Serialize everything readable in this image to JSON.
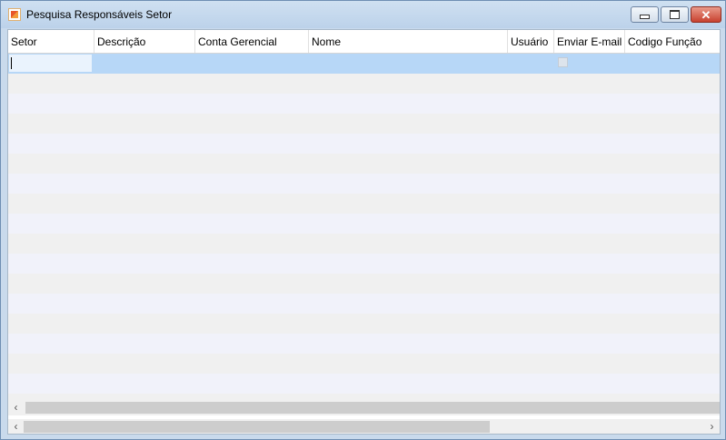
{
  "window": {
    "title": "Pesquisa Responsáveis Setor"
  },
  "grid": {
    "columns": [
      "Setor",
      "Descrição",
      "Conta Gerencial",
      "Nome",
      "Usuário",
      "Enviar E-mail",
      "Codigo Função"
    ],
    "rows": [
      {
        "setor": "",
        "descricao": "",
        "conta_gerencial": "",
        "nome": "",
        "usuario": "",
        "enviar_email": false,
        "codigo_funcao": ""
      }
    ],
    "selected_row": 0
  },
  "icons": {
    "app": "app-icon",
    "minimize": "minimize-icon",
    "maximize": "maximize-icon",
    "close": "close-icon",
    "scroll_left": "chevron-left-icon",
    "scroll_right": "chevron-right-icon"
  },
  "labels": {
    "close_glyph": "✕",
    "left_arrow": "‹",
    "right_arrow": "›"
  },
  "colors": {
    "selected_row": "#b7d7f7",
    "title_bar": "#c9daec",
    "close_button": "#c8412f"
  }
}
